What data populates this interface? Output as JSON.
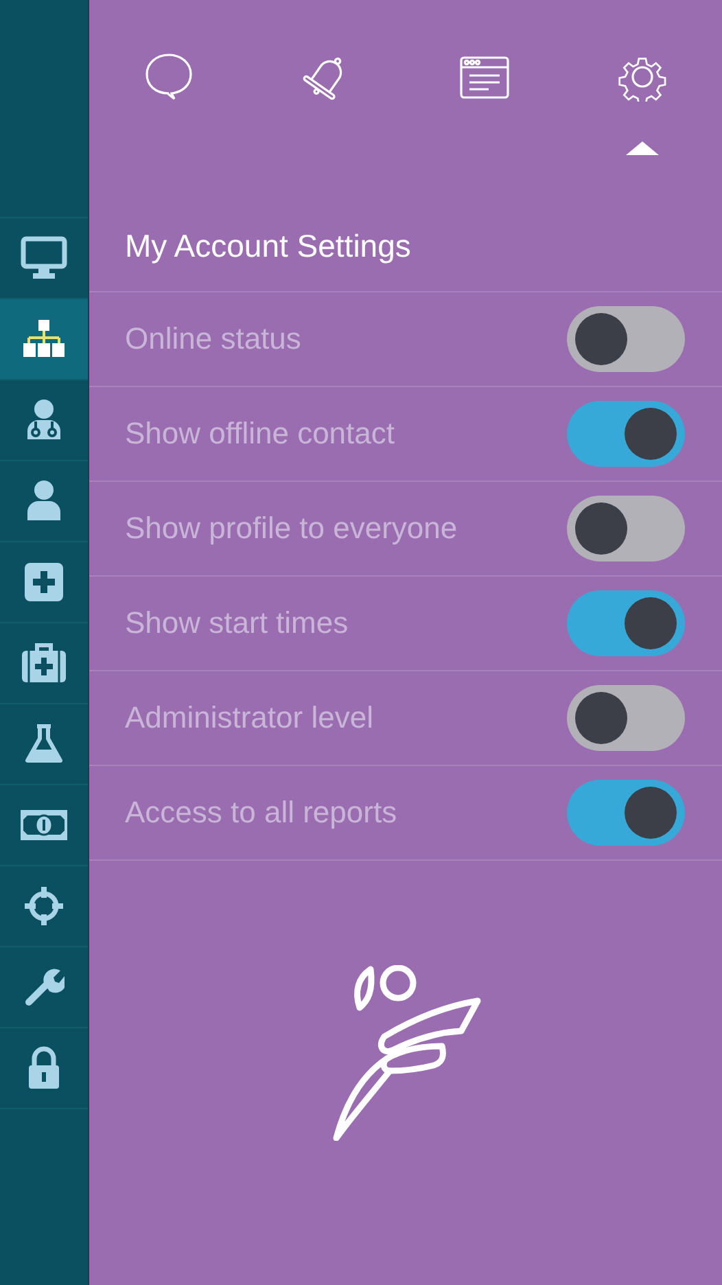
{
  "sidebar": {
    "items": [
      {
        "kind": "monitor",
        "selected": false
      },
      {
        "kind": "hierarchy",
        "selected": true
      },
      {
        "kind": "doctor",
        "selected": false
      },
      {
        "kind": "person",
        "selected": false
      },
      {
        "kind": "plus",
        "selected": false
      },
      {
        "kind": "kit",
        "selected": false
      },
      {
        "kind": "flask",
        "selected": false
      },
      {
        "kind": "money",
        "selected": false
      },
      {
        "kind": "target",
        "selected": false
      },
      {
        "kind": "wrench",
        "selected": false
      },
      {
        "kind": "lock",
        "selected": false
      }
    ]
  },
  "header": {
    "tabs": [
      {
        "kind": "chat",
        "selected": false
      },
      {
        "kind": "bell",
        "selected": false
      },
      {
        "kind": "browser",
        "selected": false
      },
      {
        "kind": "gear",
        "selected": true
      }
    ]
  },
  "settings": {
    "title": "My Account Settings",
    "rows": [
      {
        "label": "Online status",
        "on": false
      },
      {
        "label": "Show offline contact",
        "on": true
      },
      {
        "label": "Show profile to everyone",
        "on": false
      },
      {
        "label": "Show start times",
        "on": true
      },
      {
        "label": "Administrator level",
        "on": false
      },
      {
        "label": "Access to all reports",
        "on": true
      }
    ]
  }
}
